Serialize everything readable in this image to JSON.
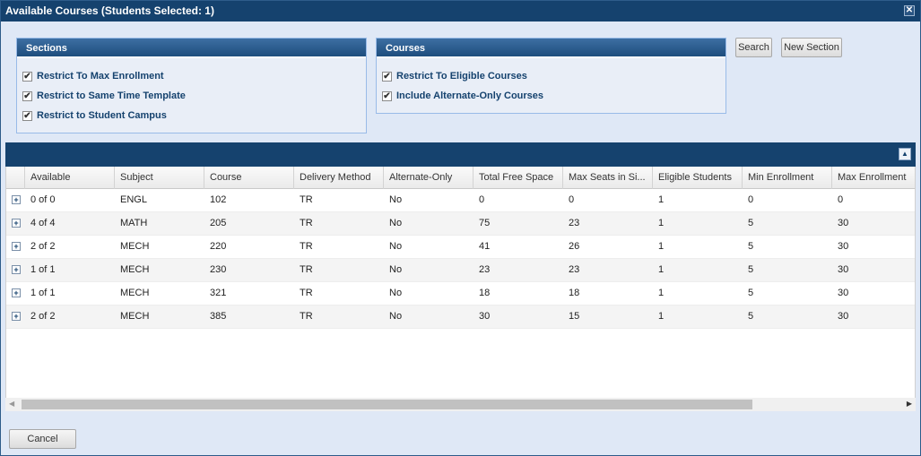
{
  "window": {
    "title": "Available Courses (Students Selected: 1)",
    "close_symbol": "✕"
  },
  "sections": {
    "title": "Sections",
    "options": [
      {
        "label": "Restrict To Max Enrollment",
        "checked": true
      },
      {
        "label": "Restrict to Same Time Template",
        "checked": true
      },
      {
        "label": "Restrict to Student Campus",
        "checked": true
      }
    ]
  },
  "courses": {
    "title": "Courses",
    "options": [
      {
        "label": "Restrict To Eligible Courses",
        "checked": true
      },
      {
        "label": "Include Alternate-Only Courses",
        "checked": true
      }
    ]
  },
  "buttons": {
    "search": "Search",
    "new_section": "New Section",
    "cancel": "Cancel"
  },
  "grid": {
    "columns": [
      "Available",
      "Subject",
      "Course",
      "Delivery Method",
      "Alternate-Only",
      "Total Free Space",
      "Max Seats in Si...",
      "Eligible Students",
      "Min Enrollment",
      "Max Enrollment"
    ],
    "rows": [
      [
        "0 of 0",
        "ENGL",
        "102",
        "TR",
        "No",
        "0",
        "0",
        "1",
        "0",
        "0"
      ],
      [
        "4 of 4",
        "MATH",
        "205",
        "TR",
        "No",
        "75",
        "23",
        "1",
        "5",
        "30"
      ],
      [
        "2 of 2",
        "MECH",
        "220",
        "TR",
        "No",
        "41",
        "26",
        "1",
        "5",
        "30"
      ],
      [
        "1 of 1",
        "MECH",
        "230",
        "TR",
        "No",
        "23",
        "23",
        "1",
        "5",
        "30"
      ],
      [
        "1 of 1",
        "MECH",
        "321",
        "TR",
        "No",
        "18",
        "18",
        "1",
        "5",
        "30"
      ],
      [
        "2 of 2",
        "MECH",
        "385",
        "TR",
        "No",
        "30",
        "15",
        "1",
        "5",
        "30"
      ]
    ]
  },
  "colors": {
    "title_bar": "#15426e",
    "panel_bg": "#dfe8f6",
    "header_text": "#15426e"
  }
}
